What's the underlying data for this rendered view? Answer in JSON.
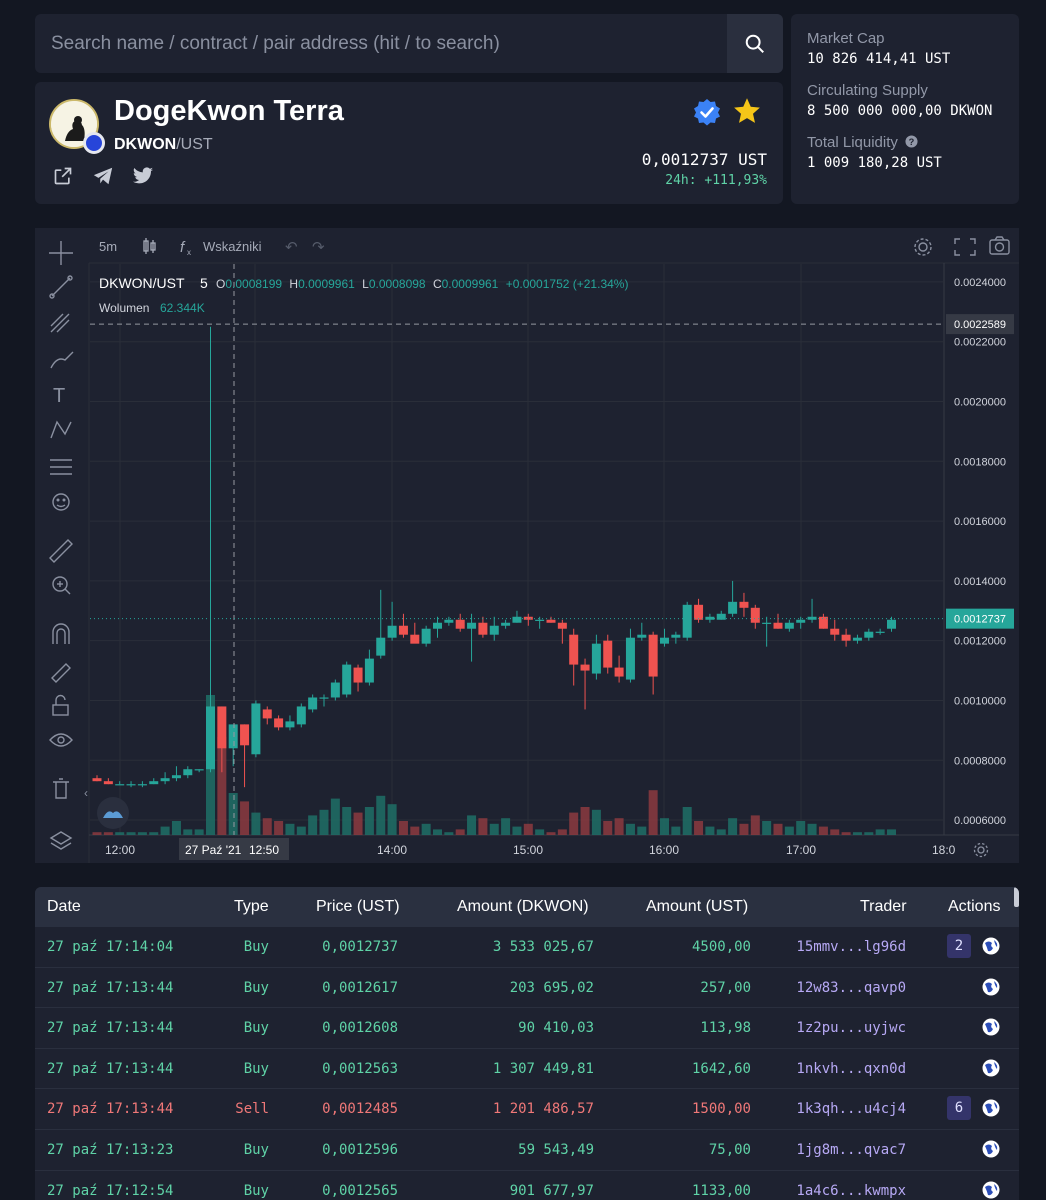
{
  "search": {
    "placeholder": "Search name / contract / pair address (hit / to search)"
  },
  "token": {
    "name": "DogeKwon Terra",
    "base": "DKWON",
    "quote": "/UST",
    "price": "0,0012737 UST",
    "change": "24h: +111,93%"
  },
  "stats": {
    "market_cap_label": "Market Cap",
    "market_cap": "10 826 414,41 UST",
    "supply_label": "Circulating Supply",
    "supply": "8 500 000 000,00 DKWON",
    "liquidity_label": "Total Liquidity",
    "liquidity": "1 009 180,28 UST"
  },
  "chart": {
    "interval": "5m",
    "indicators_label": "Wskaźniki",
    "symbol": "DKWON/UST",
    "symbol_interval": "5",
    "ohlc": {
      "o_label": "O",
      "o": "0.0008199",
      "h_label": "H",
      "h": "0.0009961",
      "l_label": "L",
      "l": "0.0008098",
      "c_label": "C",
      "c": "0.0009961",
      "chg": "+0.0001752 (+21.34%)"
    },
    "volume_label": "Wolumen",
    "volume_value": "62.344K",
    "crosshair_price": "0.0022589",
    "last_price": "0.0012737",
    "crosshair_time": "27 Paź '21",
    "crosshair_time2": "12:50"
  },
  "chart_data": {
    "type": "candlestick",
    "y_ticks": [
      "0.0024000",
      "0.0022000",
      "0.0020000",
      "0.0018000",
      "0.0016000",
      "0.0014000",
      "0.0012000",
      "0.0010000",
      "0.0008000",
      "0.0006000"
    ],
    "ylim": [
      0.00055,
      0.00246
    ],
    "x_ticks": [
      "12:00",
      "14:00",
      "15:00",
      "16:00",
      "17:00",
      "18:0"
    ],
    "crosshair_price_value": 0.0022589,
    "last_price_value": 0.0012737,
    "candles": [
      [
        0.00074,
        0.00075,
        0.00073,
        0.00073
      ],
      [
        0.00073,
        0.00074,
        0.00072,
        0.00072
      ],
      [
        0.00072,
        0.00073,
        0.00072,
        0.00072
      ],
      [
        0.00072,
        0.00073,
        0.00071,
        0.00072
      ],
      [
        0.00072,
        0.00073,
        0.00071,
        0.00072
      ],
      [
        0.00072,
        0.00074,
        0.00072,
        0.00073
      ],
      [
        0.00073,
        0.00076,
        0.00072,
        0.00074
      ],
      [
        0.00074,
        0.00078,
        0.00073,
        0.00075
      ],
      [
        0.00075,
        0.00078,
        0.00074,
        0.00077
      ],
      [
        0.00077,
        0.00077,
        0.00076,
        0.00077
      ],
      [
        0.00077,
        0.00225,
        0.00076,
        0.00098
      ],
      [
        0.00098,
        0.00098,
        0.00076,
        0.00084
      ],
      [
        0.00084,
        0.0009,
        0.00078,
        0.00092
      ],
      [
        0.00092,
        0.00092,
        0.00071,
        0.00085
      ],
      [
        0.00082,
        0.001,
        0.00081,
        0.00099
      ],
      [
        0.00097,
        0.00098,
        0.00092,
        0.00094
      ],
      [
        0.00094,
        0.00095,
        0.0009,
        0.00091
      ],
      [
        0.00091,
        0.00095,
        0.0009,
        0.00093
      ],
      [
        0.00092,
        0.00099,
        0.00091,
        0.00098
      ],
      [
        0.00097,
        0.00102,
        0.00096,
        0.00101
      ],
      [
        0.00101,
        0.00102,
        0.00098,
        0.00101
      ],
      [
        0.00101,
        0.00107,
        0.001,
        0.00106
      ],
      [
        0.00102,
        0.00113,
        0.00101,
        0.00112
      ],
      [
        0.00111,
        0.00112,
        0.00103,
        0.00106
      ],
      [
        0.00106,
        0.00117,
        0.00105,
        0.00114
      ],
      [
        0.00115,
        0.00137,
        0.00114,
        0.00121
      ],
      [
        0.00121,
        0.00133,
        0.0012,
        0.00125
      ],
      [
        0.00125,
        0.00129,
        0.00121,
        0.00122
      ],
      [
        0.00122,
        0.00126,
        0.0012,
        0.00119
      ],
      [
        0.00119,
        0.00125,
        0.00118,
        0.00124
      ],
      [
        0.00124,
        0.00128,
        0.00121,
        0.00126
      ],
      [
        0.00126,
        0.00128,
        0.00125,
        0.00127
      ],
      [
        0.00127,
        0.00129,
        0.00123,
        0.00124
      ],
      [
        0.00124,
        0.00129,
        0.00113,
        0.00126
      ],
      [
        0.00126,
        0.00128,
        0.00121,
        0.00122
      ],
      [
        0.00122,
        0.00128,
        0.0012,
        0.00125
      ],
      [
        0.00125,
        0.00127,
        0.00124,
        0.00126
      ],
      [
        0.00126,
        0.0013,
        0.00126,
        0.00128
      ],
      [
        0.00128,
        0.00129,
        0.00125,
        0.00127
      ],
      [
        0.00127,
        0.00128,
        0.00124,
        0.00127
      ],
      [
        0.00127,
        0.00128,
        0.00126,
        0.00126
      ],
      [
        0.00126,
        0.00127,
        0.00119,
        0.00124
      ],
      [
        0.00122,
        0.00124,
        0.00105,
        0.00112
      ],
      [
        0.00112,
        0.00114,
        0.00097,
        0.0011
      ],
      [
        0.00109,
        0.00122,
        0.00107,
        0.00119
      ],
      [
        0.0012,
        0.00122,
        0.00109,
        0.00111
      ],
      [
        0.00111,
        0.00115,
        0.00106,
        0.00108
      ],
      [
        0.00107,
        0.00124,
        0.00106,
        0.00121
      ],
      [
        0.00121,
        0.00126,
        0.0012,
        0.00122
      ],
      [
        0.00122,
        0.00123,
        0.00102,
        0.00108
      ],
      [
        0.00119,
        0.00124,
        0.00118,
        0.00121
      ],
      [
        0.00121,
        0.00123,
        0.00119,
        0.00122
      ],
      [
        0.00121,
        0.00133,
        0.0012,
        0.00132
      ],
      [
        0.00132,
        0.00134,
        0.00126,
        0.00127
      ],
      [
        0.00127,
        0.00129,
        0.00126,
        0.00128
      ],
      [
        0.00127,
        0.0013,
        0.00127,
        0.00129
      ],
      [
        0.00129,
        0.0014,
        0.00128,
        0.00133
      ],
      [
        0.00133,
        0.00136,
        0.00128,
        0.00131
      ],
      [
        0.00131,
        0.00132,
        0.00124,
        0.00126
      ],
      [
        0.00126,
        0.00128,
        0.00118,
        0.00126
      ],
      [
        0.00126,
        0.00129,
        0.00124,
        0.00124
      ],
      [
        0.00124,
        0.00127,
        0.00123,
        0.00126
      ],
      [
        0.00126,
        0.00128,
        0.00124,
        0.00127
      ],
      [
        0.00127,
        0.00134,
        0.00126,
        0.00128
      ],
      [
        0.00128,
        0.00129,
        0.00124,
        0.00124
      ],
      [
        0.00124,
        0.00127,
        0.0012,
        0.00122
      ],
      [
        0.00122,
        0.00124,
        0.00118,
        0.0012
      ],
      [
        0.0012,
        0.00122,
        0.00119,
        0.00121
      ],
      [
        0.00121,
        0.00124,
        0.0012,
        0.00123
      ],
      [
        0.00123,
        0.00124,
        0.00122,
        0.00123
      ],
      [
        0.00124,
        0.00128,
        0.00123,
        0.00127
      ]
    ],
    "volumes": [
      1,
      1,
      1,
      1,
      1,
      1,
      3,
      5,
      2,
      2,
      50,
      35,
      15,
      12,
      8,
      6,
      5,
      4,
      3,
      7,
      9,
      13,
      10,
      8,
      10,
      14,
      11,
      5,
      3,
      4,
      2,
      1,
      2,
      7,
      6,
      4,
      6,
      3,
      4,
      2,
      1,
      2,
      8,
      10,
      9,
      5,
      6,
      4,
      3,
      16,
      6,
      3,
      10,
      5,
      3,
      2,
      6,
      4,
      7,
      5,
      4,
      3,
      5,
      4,
      3,
      2,
      1,
      1,
      1,
      2,
      2
    ]
  },
  "trades": {
    "headers": [
      "Date",
      "Type",
      "Price (UST)",
      "Amount (DKWON)",
      "Amount (UST)",
      "Trader",
      "Actions"
    ],
    "rows": [
      {
        "date": "27 paź 17:14:04",
        "type": "Buy",
        "price": "0,0012737",
        "amount_token": "3 533 025,67",
        "amount_ust": "4500,00",
        "trader": "15mmv...lg96d",
        "count": "2"
      },
      {
        "date": "27 paź 17:13:44",
        "type": "Buy",
        "price": "0,0012617",
        "amount_token": "203 695,02",
        "amount_ust": "257,00",
        "trader": "12w83...qavp0",
        "count": ""
      },
      {
        "date": "27 paź 17:13:44",
        "type": "Buy",
        "price": "0,0012608",
        "amount_token": "90 410,03",
        "amount_ust": "113,98",
        "trader": "1z2pu...uyjwc",
        "count": ""
      },
      {
        "date": "27 paź 17:13:44",
        "type": "Buy",
        "price": "0,0012563",
        "amount_token": "1 307 449,81",
        "amount_ust": "1642,60",
        "trader": "1nkvh...qxn0d",
        "count": ""
      },
      {
        "date": "27 paź 17:13:44",
        "type": "Sell",
        "price": "0,0012485",
        "amount_token": "1 201 486,57",
        "amount_ust": "1500,00",
        "trader": "1k3qh...u4cj4",
        "count": "6"
      },
      {
        "date": "27 paź 17:13:23",
        "type": "Buy",
        "price": "0,0012596",
        "amount_token": "59 543,49",
        "amount_ust": "75,00",
        "trader": "1jg8m...qvac7",
        "count": ""
      },
      {
        "date": "27 paź 17:12:54",
        "type": "Buy",
        "price": "0,0012565",
        "amount_token": "901 677,97",
        "amount_ust": "1133,00",
        "trader": "1a4c6...kwmpx",
        "count": ""
      }
    ]
  },
  "colors": {
    "up": "#26a69a",
    "down": "#ef5350",
    "buy_text": "#5fd3a7",
    "sell_text": "#f07878",
    "star": "#f5c518",
    "verified": "#3b82f6"
  }
}
